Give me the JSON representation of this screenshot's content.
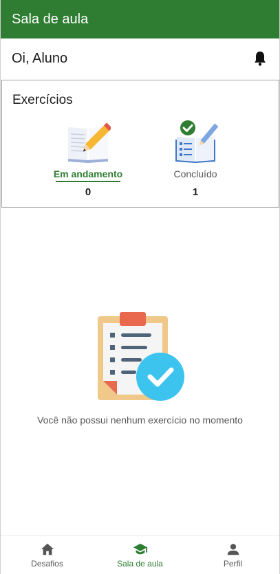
{
  "appbar": {
    "title": "Sala de aula"
  },
  "header": {
    "greeting": "Oi, Aluno",
    "bell_icon": "bell-icon"
  },
  "exercises": {
    "title": "Exercícios",
    "tabs": [
      {
        "label": "Em andamento",
        "count": "0",
        "icon": "open-book-pencil-icon",
        "active": true
      },
      {
        "label": "Concluído",
        "count": "1",
        "icon": "book-check-icon",
        "active": false
      }
    ]
  },
  "empty_state": {
    "icon": "clipboard-check-icon",
    "message": "Você não possui nenhum exercício no momento"
  },
  "bottom_nav": {
    "items": [
      {
        "label": "Desafios",
        "icon": "home-icon",
        "active": false
      },
      {
        "label": "Sala de aula",
        "icon": "graduation-cap-icon",
        "active": true
      },
      {
        "label": "Perfil",
        "icon": "person-icon",
        "active": false
      }
    ]
  },
  "colors": {
    "primary": "#2e7d32",
    "accent_check": "#4fc3f7"
  }
}
